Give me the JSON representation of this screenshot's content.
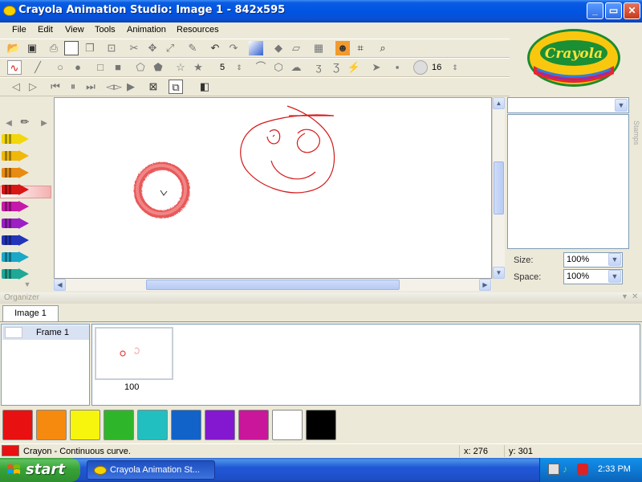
{
  "window": {
    "title": "Crayola Animation Studio: Image 1 - 842x595",
    "minimize_label": "_",
    "maximize_label": "▭",
    "close_label": "✕"
  },
  "menu": [
    "File",
    "Edit",
    "View",
    "Tools",
    "Animation",
    "Resources"
  ],
  "toolbar": {
    "shape_count": "5",
    "brush_size": "16"
  },
  "logo_text": "Crayola",
  "stamps": {
    "tab_label": "Stamps",
    "category_value": "",
    "size_label": "Size:",
    "size_value": "100%",
    "space_label": "Space:",
    "space_value": "100%"
  },
  "organizer": {
    "label": "Organizer",
    "tab": "Image 1",
    "frames": [
      {
        "name": "Frame 1"
      }
    ],
    "frame_duration": "100"
  },
  "palette": {
    "colors": [
      "#e81010",
      "#f68a0f",
      "#f7f50e",
      "#2fb52a",
      "#21bfbf",
      "#1163c9",
      "#8318d0",
      "#c9169a",
      "#ffffff",
      "#000000"
    ]
  },
  "status": {
    "color": "#e81010",
    "text": "Crayon - Continuous curve.",
    "x": "x: 276",
    "y": "y: 301"
  },
  "taskbar": {
    "start_label": "start",
    "task_label": "Crayola Animation St...",
    "clock": "2:33 PM"
  },
  "crayons": [
    "#f2d70c",
    "#f0b80a",
    "#e88b12",
    "#d81616",
    "#c51aa9",
    "#9b1fc4",
    "#2334b8",
    "#19a8c7",
    "#1fa896"
  ]
}
